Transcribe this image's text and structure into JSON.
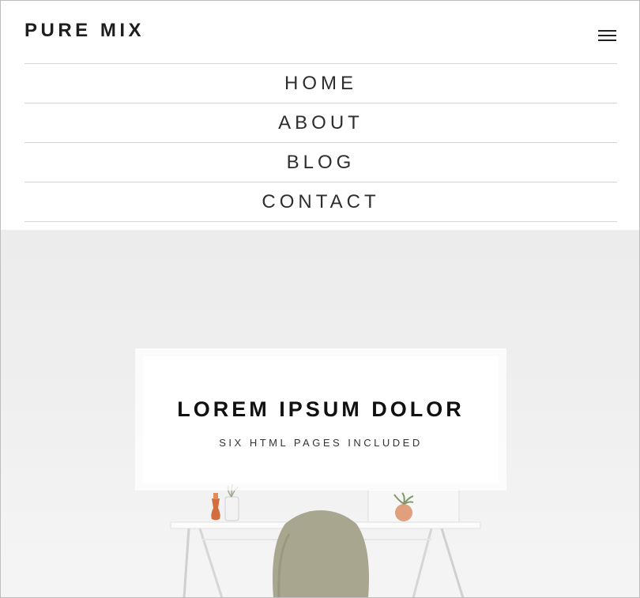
{
  "header": {
    "brand": "PURE MIX",
    "menu_icon": "hamburger-menu-icon"
  },
  "nav": {
    "items": [
      {
        "label": "HOME"
      },
      {
        "label": "ABOUT"
      },
      {
        "label": "BLOG"
      },
      {
        "label": "CONTACT"
      }
    ]
  },
  "hero": {
    "title": "LOREM IPSUM DOLOR",
    "subtitle": "SIX HTML PAGES INCLUDED"
  }
}
